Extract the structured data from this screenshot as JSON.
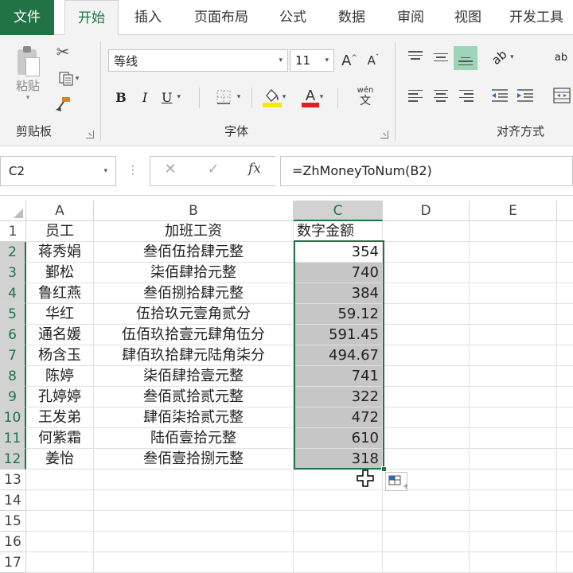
{
  "tabs": [
    "文件",
    "开始",
    "插入",
    "页面布局",
    "公式",
    "数据",
    "审阅",
    "视图",
    "开发工具"
  ],
  "ribbon": {
    "clipboard": {
      "paste_label": "粘贴",
      "group_label": "剪贴板"
    },
    "font": {
      "name": "等线",
      "size": "11",
      "group_label": "字体",
      "phonetic_top": "wén",
      "phonetic_bottom": "文"
    },
    "alignment": {
      "group_label": "对齐方式",
      "wrap_text_glyph": "ab"
    },
    "colors": {
      "fill_highlight": "#f5e900",
      "font_color": "#e02020",
      "accent": "#217346",
      "selected_align": "#9fd5b7"
    }
  },
  "formula_bar": {
    "name_box": "C2",
    "formula": "=ZhMoneyToNum(B2)",
    "fx_label": "fx"
  },
  "sheet": {
    "columns": [
      "A",
      "B",
      "C",
      "D",
      "E"
    ],
    "selected_column": "C",
    "rows": [
      "1",
      "2",
      "3",
      "4",
      "5",
      "6",
      "7",
      "8",
      "9",
      "10",
      "11",
      "12",
      "13",
      "14",
      "15",
      "16",
      "17"
    ],
    "header_row": [
      "员工",
      "加班工资",
      "数字金额"
    ],
    "data": [
      [
        "蒋秀娟",
        "叁佰伍拾肆元整",
        "354"
      ],
      [
        "鄞松",
        "柒佰肆拾元整",
        "740"
      ],
      [
        "鲁红燕",
        "叁佰捌拾肆元整",
        "384"
      ],
      [
        "华红",
        "伍拾玖元壹角贰分",
        "59.12"
      ],
      [
        "通名媛",
        "伍佰玖拾壹元肆角伍分",
        "591.45"
      ],
      [
        "杨含玉",
        "肆佰玖拾肆元陆角柒分",
        "494.67"
      ],
      [
        "陈婷",
        "柒佰肆拾壹元整",
        "741"
      ],
      [
        "孔婷婷",
        "叁佰贰拾贰元整",
        "322"
      ],
      [
        "王发弟",
        "肆佰柒拾贰元整",
        "472"
      ],
      [
        "何紫霜",
        "陆佰壹拾元整",
        "610"
      ],
      [
        "姜怡",
        "叁佰壹拾捌元整",
        "318"
      ]
    ]
  },
  "icons": [
    "scissors-icon",
    "copy-icon",
    "format-painter-icon",
    "border-icon",
    "fill-color-icon",
    "font-color-icon",
    "phonetic-icon",
    "align-top-icon",
    "align-middle-icon",
    "align-bottom-icon",
    "orientation-icon",
    "wrap-text-icon",
    "align-left-icon",
    "align-center-icon",
    "align-right-icon",
    "decrease-indent-icon",
    "increase-indent-icon",
    "merge-center-icon",
    "cross-cursor-icon",
    "quick-analysis-icon"
  ]
}
